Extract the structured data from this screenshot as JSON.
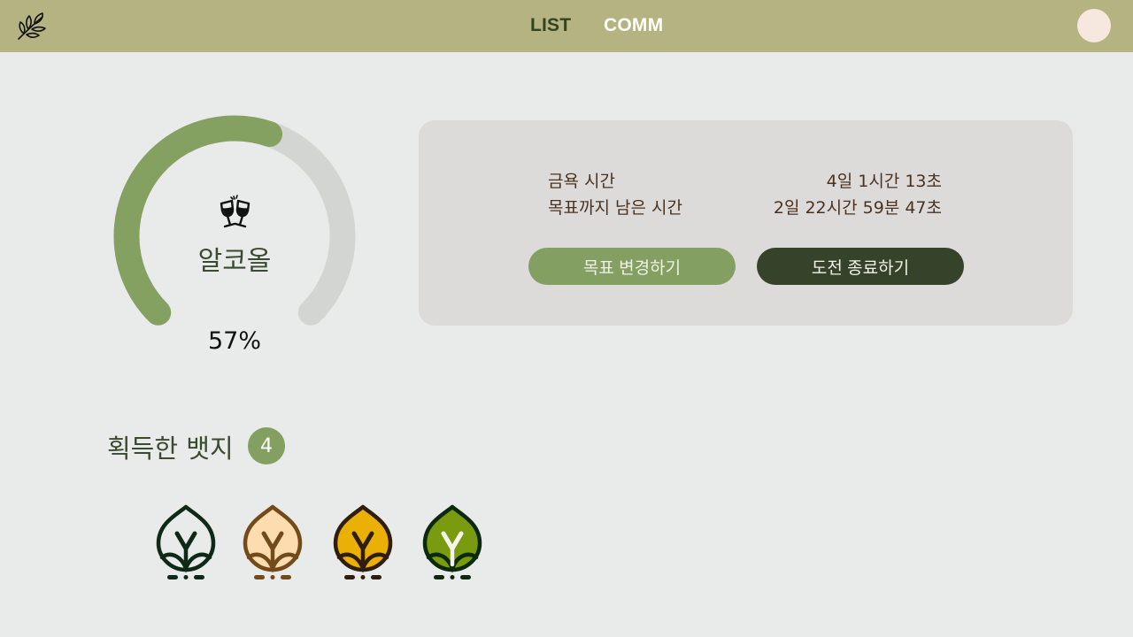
{
  "header": {
    "logo": "leaf-branch-logo",
    "nav": [
      {
        "label": "LIST"
      },
      {
        "label": "COMM"
      }
    ]
  },
  "gauge": {
    "category_icon": "cheers-glasses-icon",
    "category_label": "알코올",
    "percent_text": "57%",
    "progress_fraction": 0.57,
    "colors": {
      "progress": "#84a162",
      "track": "#d3d5d2"
    }
  },
  "stats": {
    "rows": [
      {
        "label": "금욕 시간",
        "value": "4일 1시간 13초"
      },
      {
        "label": "목표까지 남은 시간",
        "value": "2일 22시간 59분 47초"
      }
    ],
    "buttons": {
      "change_goal": "목표 변경하기",
      "end_challenge": "도전 종료하기"
    }
  },
  "badges": {
    "title": "획득한 뱃지",
    "count": "4",
    "items": [
      {
        "name": "sprout-badge-dark-green",
        "fill": "#e9ebea",
        "stroke": "#0e2a17"
      },
      {
        "name": "sprout-badge-peach",
        "fill": "#fddcb0",
        "stroke": "#734b1a"
      },
      {
        "name": "sprout-badge-gold",
        "fill": "#ebb006",
        "stroke": "#2f1d0e"
      },
      {
        "name": "sprout-badge-green",
        "fill": "#7a9b10",
        "stroke": "#0b2a0d"
      }
    ]
  }
}
